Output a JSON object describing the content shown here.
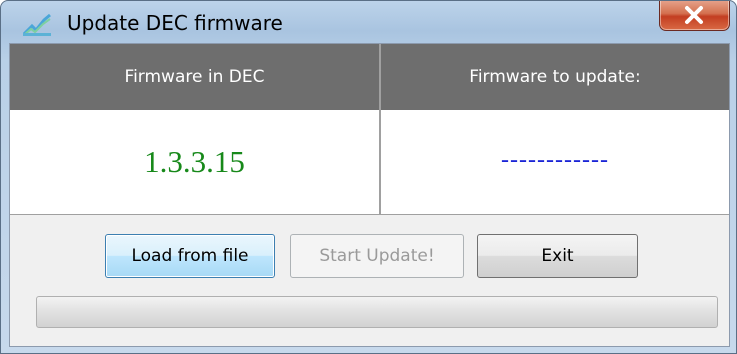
{
  "window": {
    "title": "Update DEC firmware"
  },
  "panels": {
    "current": {
      "header": "Firmware in DEC",
      "value": "1.3.3.15"
    },
    "update": {
      "header": "Firmware to update:",
      "value": "------------"
    }
  },
  "buttons": {
    "load_label": "Load from file",
    "start_label": "Start Update!",
    "exit_label": "Exit"
  },
  "progress": {
    "value": 0
  },
  "colors": {
    "current_value": "#17891a",
    "update_value": "#1a24d6",
    "header_bg": "#6e6e6e",
    "close_button": "#c33e21"
  },
  "icons": {
    "title": "app-icon",
    "close": "close-icon"
  }
}
